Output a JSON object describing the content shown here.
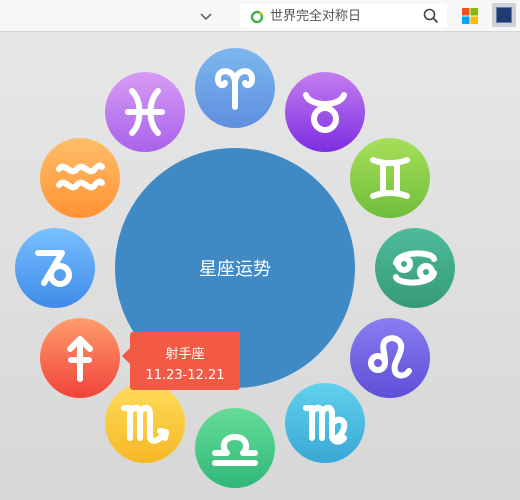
{
  "browser": {
    "search_placeholder": "世界完全对称日"
  },
  "center": {
    "label": "星座运势"
  },
  "signs": [
    {
      "key": "aries",
      "color_top": "#7bb8ee",
      "color_bottom": "#5f8ee0"
    },
    {
      "key": "taurus",
      "color_top": "#c47ef0",
      "color_bottom": "#7c2ee0"
    },
    {
      "key": "gemini",
      "color_top": "#a7df5a",
      "color_bottom": "#6fbe3a"
    },
    {
      "key": "cancer",
      "color_top": "#4fbb9a",
      "color_bottom": "#359a7a"
    },
    {
      "key": "leo",
      "color_top": "#8a7cf0",
      "color_bottom": "#5e4fd8"
    },
    {
      "key": "virgo",
      "color_top": "#60d1ee",
      "color_bottom": "#3aa7d4"
    },
    {
      "key": "libra",
      "color_top": "#67dc9a",
      "color_bottom": "#2fb878"
    },
    {
      "key": "scorpio",
      "color_top": "#ffdc5a",
      "color_bottom": "#f6b825"
    },
    {
      "key": "sagittarius",
      "color_top": "#ff9c6c",
      "color_bottom": "#f0433a"
    },
    {
      "key": "capricorn",
      "color_top": "#78c0ff",
      "color_bottom": "#3f8ae8"
    },
    {
      "key": "aquarius",
      "color_top": "#ffbe6a",
      "color_bottom": "#ff9233"
    },
    {
      "key": "pisces",
      "color_top": "#d79cf5",
      "color_bottom": "#a862ea"
    }
  ],
  "tooltip": {
    "name": "射手座",
    "dates": "11.23-12.21"
  }
}
